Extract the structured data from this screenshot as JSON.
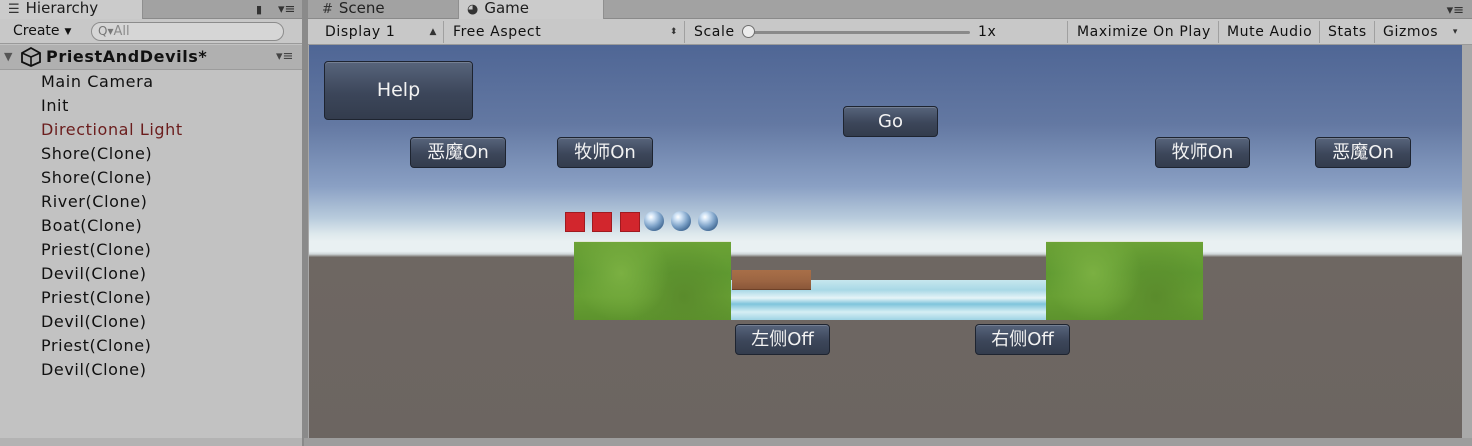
{
  "hierarchy": {
    "tab_label": "Hierarchy",
    "create_label": "Create",
    "search_placeholder": "All",
    "scene_name": "PriestAndDevils*",
    "items": [
      {
        "label": "Main Camera",
        "inactive": false
      },
      {
        "label": "Init",
        "inactive": false
      },
      {
        "label": "Directional Light",
        "inactive": true
      },
      {
        "label": "Shore(Clone)",
        "inactive": false
      },
      {
        "label": "Shore(Clone)",
        "inactive": false
      },
      {
        "label": "River(Clone)",
        "inactive": false
      },
      {
        "label": "Boat(Clone)",
        "inactive": false
      },
      {
        "label": "Priest(Clone)",
        "inactive": false
      },
      {
        "label": "Devil(Clone)",
        "inactive": false
      },
      {
        "label": "Priest(Clone)",
        "inactive": false
      },
      {
        "label": "Devil(Clone)",
        "inactive": false
      },
      {
        "label": "Priest(Clone)",
        "inactive": false
      },
      {
        "label": "Devil(Clone)",
        "inactive": false
      }
    ],
    "inactive_color": "#6b1d1d"
  },
  "tabs": {
    "scene_label": "Scene",
    "game_label": "Game"
  },
  "game_toolbar": {
    "display": "Display 1",
    "aspect": "Free Aspect",
    "scale_label": "Scale",
    "scale_value": "1x",
    "maximize_on_play": "Maximize On Play",
    "mute_audio": "Mute Audio",
    "stats": "Stats",
    "gizmos": "Gizmos"
  },
  "game_view": {
    "help_label": "Help",
    "go_label": "Go",
    "devil_on_left": "恶魔On",
    "priest_on_left": "牧师On",
    "priest_on_right": "牧师On",
    "devil_on_right": "恶魔On",
    "left_off": "左侧Off",
    "right_off": "右侧Off",
    "devil_color": "#d2262d",
    "grass_color": "#6ca236",
    "boat_color": "#a86f48"
  }
}
